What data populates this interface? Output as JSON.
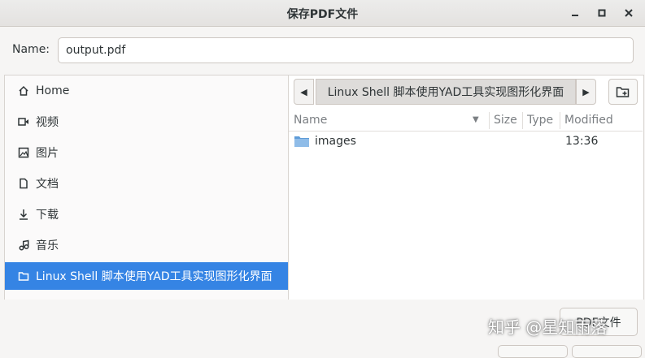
{
  "window": {
    "title": "保存PDF文件"
  },
  "name_row": {
    "label": "Name:",
    "value": "output.pdf"
  },
  "sidebar": {
    "items": [
      {
        "label": "Home",
        "icon": "home-icon"
      },
      {
        "label": "视频",
        "icon": "video-icon"
      },
      {
        "label": "图片",
        "icon": "image-icon"
      },
      {
        "label": "文档",
        "icon": "document-icon"
      },
      {
        "label": "下载",
        "icon": "download-icon"
      },
      {
        "label": "音乐",
        "icon": "music-icon"
      },
      {
        "label": "Linux Shell 脚本使用YAD工具实现图形化界面",
        "icon": "folder-icon",
        "selected": true
      }
    ]
  },
  "pathbar": {
    "crumb": "Linux Shell 脚本使用YAD工具实现图形化界面"
  },
  "columns": {
    "name": "Name",
    "size": "Size",
    "type": "Type",
    "modified": "Modified"
  },
  "files": [
    {
      "name": "images",
      "modified": "13:36",
      "icon": "folder-icon"
    }
  ],
  "footer": {
    "filter": "PDF文件",
    "watermark": "知乎 @星知雨落"
  },
  "colors": {
    "accent": "#3584e4",
    "folder": "#5e9cd8"
  }
}
